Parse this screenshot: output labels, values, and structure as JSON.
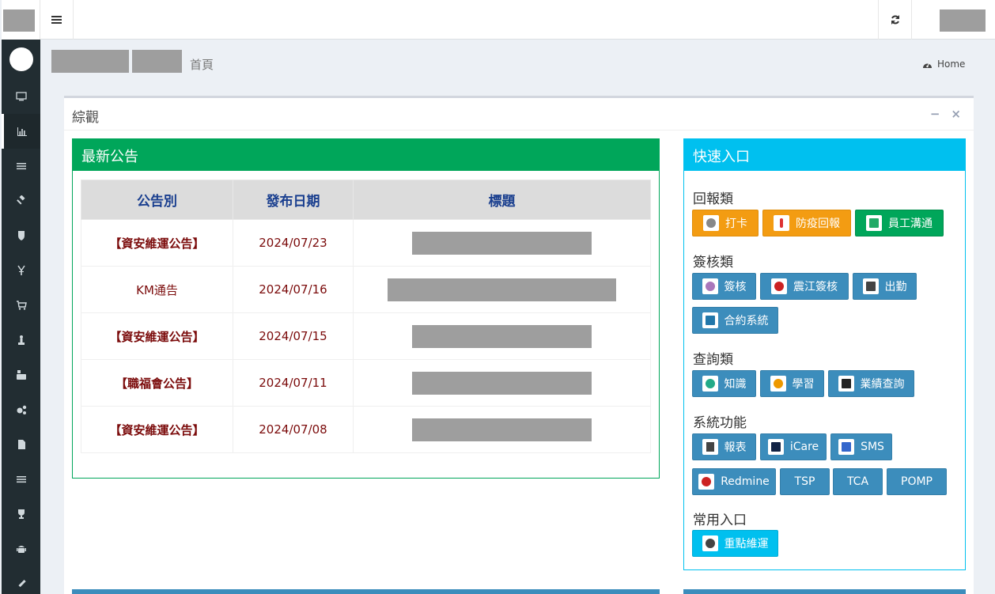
{
  "header": {
    "home_breadcrumb": "Home",
    "page_subtitle": "首頁"
  },
  "overview": {
    "title": "綜觀",
    "collapse": "−",
    "close": "×"
  },
  "announcements": {
    "title": "最新公告",
    "columns": [
      "公告別",
      "發布日期",
      "標題"
    ],
    "rows": [
      {
        "category": "【資安維運公告】",
        "date": "2024/07/23"
      },
      {
        "category": "KM通告",
        "date": "2024/07/16"
      },
      {
        "category": "【資安維運公告】",
        "date": "2024/07/15"
      },
      {
        "category": "【職福會公告】",
        "date": "2024/07/11"
      },
      {
        "category": "【資安維運公告】",
        "date": "2024/07/08"
      }
    ]
  },
  "quick": {
    "title": "快速入口",
    "sections": [
      {
        "label": "回報類",
        "buttons": [
          {
            "label": "打卡",
            "color": "#f39c12",
            "icon": "clock-icon"
          },
          {
            "label": "防疫回報",
            "color": "#f39c12",
            "icon": "thermometer-icon"
          },
          {
            "label": "員工溝通",
            "color": "#00a65a",
            "icon": "speech-icon"
          }
        ]
      },
      {
        "label": "簽核類",
        "buttons": [
          {
            "label": "簽核",
            "color": "#3c8dbc",
            "icon": "sign-icon"
          },
          {
            "label": "震江簽核",
            "color": "#3c8dbc",
            "icon": "dollar-icon"
          },
          {
            "label": "出勤",
            "color": "#3c8dbc",
            "icon": "calendar-icon"
          },
          {
            "label": "合約系統",
            "color": "#3c8dbc",
            "icon": "ecs-icon"
          }
        ]
      },
      {
        "label": "查詢類",
        "buttons": [
          {
            "label": "知識",
            "color": "#3c8dbc",
            "icon": "eye-icon"
          },
          {
            "label": "學習",
            "color": "#3c8dbc",
            "icon": "learn-icon"
          },
          {
            "label": "業績查詢",
            "color": "#3c8dbc",
            "icon": "chart-icon"
          }
        ]
      },
      {
        "label": "系統功能",
        "buttons": [
          {
            "label": "報表",
            "color": "#3c8dbc",
            "icon": "report-icon"
          },
          {
            "label": "iCare",
            "color": "#3c8dbc",
            "icon": "icare-icon"
          },
          {
            "label": "SMS",
            "color": "#3c8dbc",
            "icon": "sms-icon"
          },
          {
            "label": "Redmine",
            "color": "#3c8dbc",
            "icon": "redmine-icon"
          },
          {
            "label": "TSP",
            "color": "#3c8dbc",
            "icon": ""
          },
          {
            "label": "TCA",
            "color": "#3c8dbc",
            "icon": ""
          },
          {
            "label": "POMP",
            "color": "#3c8dbc",
            "icon": ""
          }
        ]
      },
      {
        "label": "常用入口",
        "buttons": [
          {
            "label": "重點維運",
            "color": "#00c0ef",
            "icon": "maintenance-icon"
          }
        ]
      }
    ]
  },
  "sidebar": {
    "icons": [
      "monitor-icon",
      "bar-chart-icon",
      "list-icon",
      "gavel-icon",
      "shield-icon",
      "yen-icon",
      "cart-icon",
      "chess-icon",
      "youtube-icon",
      "cogs-icon",
      "file-icon",
      "list-icon",
      "trophy-icon",
      "android-icon",
      "eyedropper-icon"
    ]
  }
}
